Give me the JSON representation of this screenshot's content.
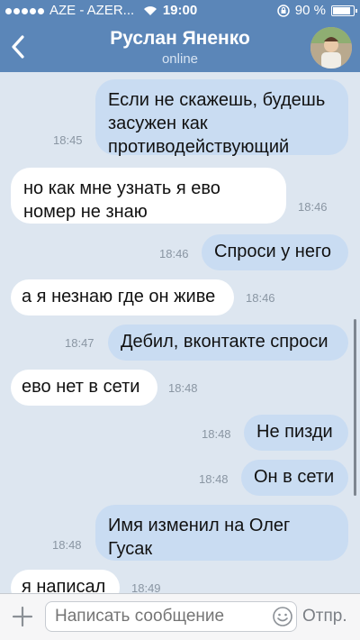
{
  "status_bar": {
    "carrier": "AZE - AZER...",
    "time": "19:00",
    "battery_text": "90 %",
    "battery_level": 0.9
  },
  "nav": {
    "contact_name": "Руслан Яненко",
    "contact_status": "online"
  },
  "messages": [
    {
      "dir": "out",
      "text": "Если не скажешь, будешь\nзасужен как\nпротиводействующий",
      "time": "18:45"
    },
    {
      "dir": "in",
      "text": "но как мне узнать я ево\nномер не знаю",
      "time": "18:46"
    },
    {
      "dir": "out",
      "text": "Спроси у него",
      "time": "18:46"
    },
    {
      "dir": "in",
      "text": "а я незнаю где он живе",
      "time": "18:46"
    },
    {
      "dir": "out",
      "text": "Дебил, вконтакте спроси",
      "time": "18:47"
    },
    {
      "dir": "in",
      "text": "ево нет в сети",
      "time": "18:48"
    },
    {
      "dir": "out",
      "text": "Не пизди",
      "time": "18:48"
    },
    {
      "dir": "out",
      "text": "Он в сети",
      "time": "18:48"
    },
    {
      "dir": "out",
      "text": "Имя изменил на Олег\nГусак",
      "time": "18:48"
    },
    {
      "dir": "in",
      "text": "я написал",
      "time": "18:49"
    }
  ],
  "composer": {
    "placeholder": "Написать сообщение",
    "send_label": "Отпр."
  }
}
